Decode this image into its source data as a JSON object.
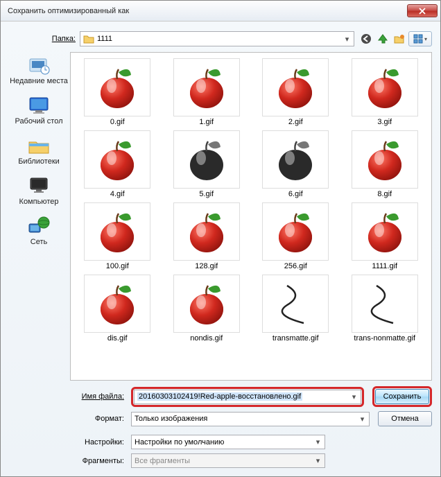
{
  "window": {
    "title": "Сохранить оптимизированный как"
  },
  "topbar": {
    "folder_label": "Папка:",
    "folder_name": "1111"
  },
  "sidebar": [
    {
      "id": "recent",
      "label": "Недавние места"
    },
    {
      "id": "desktop",
      "label": "Рабочий стол"
    },
    {
      "id": "libraries",
      "label": "Библиотеки"
    },
    {
      "id": "computer",
      "label": "Компьютер"
    },
    {
      "id": "network",
      "label": "Сеть"
    }
  ],
  "files": [
    {
      "name": "0.gif",
      "kind": "apple-red"
    },
    {
      "name": "1.gif",
      "kind": "apple-red"
    },
    {
      "name": "2.gif",
      "kind": "apple-red"
    },
    {
      "name": "3.gif",
      "kind": "apple-red"
    },
    {
      "name": "4.gif",
      "kind": "apple-red"
    },
    {
      "name": "5.gif",
      "kind": "apple-bw"
    },
    {
      "name": "6.gif",
      "kind": "apple-bw"
    },
    {
      "name": "8.gif",
      "kind": "apple-red"
    },
    {
      "name": "100.gif",
      "kind": "apple-red"
    },
    {
      "name": "128.gif",
      "kind": "apple-red"
    },
    {
      "name": "256.gif",
      "kind": "apple-red"
    },
    {
      "name": "1111.gif",
      "kind": "apple-red"
    },
    {
      "name": "dis.gif",
      "kind": "apple-red"
    },
    {
      "name": "nondis.gif",
      "kind": "apple-red"
    },
    {
      "name": "transmatte.gif",
      "kind": "curve"
    },
    {
      "name": "trans-nonmatte.gif",
      "kind": "curve"
    }
  ],
  "form": {
    "filename_label": "Имя файла:",
    "filename_value": "20160303102419!Red-apple-восстановлено.gif",
    "format_label": "Формат:",
    "format_value": "Только изображения",
    "settings_label": "Настройки:",
    "settings_value": "Настройки по умолчанию",
    "fragments_label": "Фрагменты:",
    "fragments_value": "Все фрагменты",
    "save_btn": "Сохранить",
    "cancel_btn": "Отмена"
  }
}
